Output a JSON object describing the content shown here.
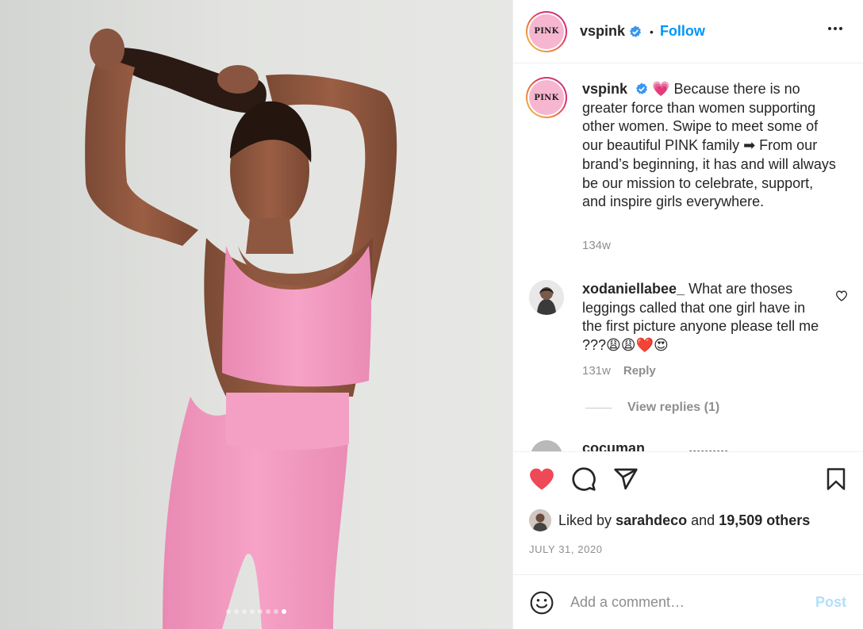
{
  "account": {
    "username": "vspink",
    "avatar_text": "PINK",
    "follow_label": "Follow",
    "bullet": "•"
  },
  "caption": {
    "emoji": "💗",
    "text": "Because there is no greater force than women supporting other women. Swipe to meet some of our beautiful PINK family ➡ From our brand’s beginning, it has and will always be our mission to celebrate, support, and inspire girls everywhere.",
    "time": "134w"
  },
  "comments": [
    {
      "username": "xodaniellabee_",
      "text": "What are thoses leggings called that one girl have in the first picture anyone please tell me ???😩😩❤️😍",
      "time": "131w",
      "reply_label": "Reply",
      "view_replies_label": "View replies (1)"
    }
  ],
  "next_comment_preview": "cocuman_____ ..........",
  "likes": {
    "prefix": "Liked by",
    "user": "sarahdeco",
    "connector": "and",
    "others": "19,509 others"
  },
  "post_date": "JULY 31, 2020",
  "comment_box": {
    "placeholder": "Add a comment…",
    "post_label": "Post"
  },
  "carousel": {
    "count": 8,
    "active_index": 7
  },
  "colors": {
    "like_red": "#ed4956",
    "link_blue": "#0095f6",
    "post_disabled": "#b2dffc",
    "verified_blue": "#3897f0",
    "outfit_pink": "#f49ac1"
  }
}
